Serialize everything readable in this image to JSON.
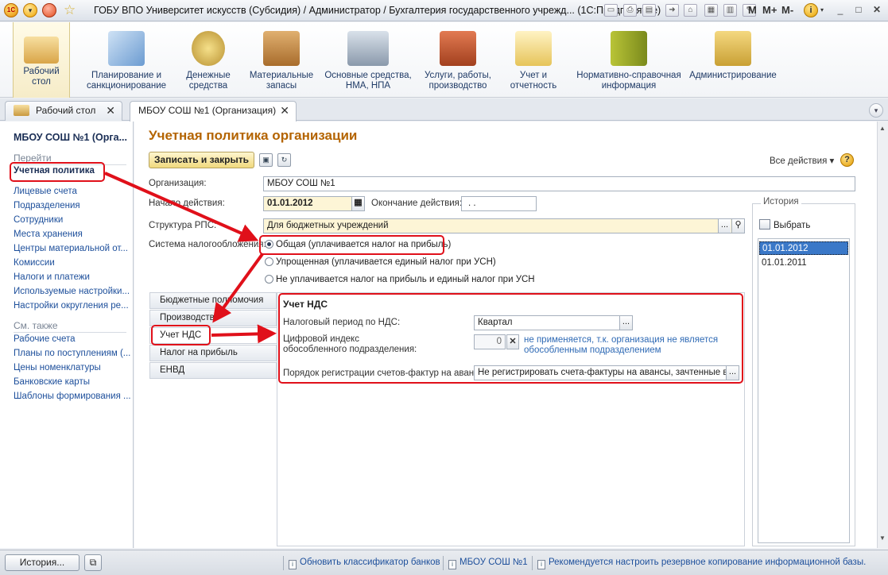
{
  "titlebar": {
    "title": "ГОБУ ВПО Университет искусств (Субсидия) / Администратор / Бухгалтерия государственного учрежд... (1С:Предприятие)",
    "m_labels": [
      "M",
      "M+",
      "M-"
    ]
  },
  "ribbon": {
    "items": [
      {
        "label": "Рабочий\nстол",
        "icon": "desk-icon"
      },
      {
        "label": "Планирование и\nсанкционирование",
        "icon": "planning-chart-icon"
      },
      {
        "label": "Денежные\nсредства",
        "icon": "coins-icon"
      },
      {
        "label": "Материальные\nзапасы",
        "icon": "boxes-icon"
      },
      {
        "label": "Основные средства,\nНМА, НПА",
        "icon": "truck-icon"
      },
      {
        "label": "Услуги, работы,\nпроизводство",
        "icon": "toolbox-icon"
      },
      {
        "label": "Учет и\nотчетность",
        "icon": "reports-icon"
      },
      {
        "label": "Нормативно-справочная\nинформация",
        "icon": "binders-icon"
      },
      {
        "label": "Администрирование",
        "icon": "admin-computer-icon"
      }
    ]
  },
  "tabs": [
    {
      "label": "Рабочий стол",
      "active": false
    },
    {
      "label": "МБОУ СОШ №1 (Организация)",
      "active": true
    }
  ],
  "left_panel": {
    "title": "МБОУ СОШ №1 (Орга...",
    "goto_section": "Перейти",
    "goto_items": [
      "Учетная политика",
      "Лицевые счета",
      "Подразделения",
      "Сотрудники",
      "Места хранения",
      "Центры материальной от...",
      "Комиссии",
      "Налоги и платежи",
      "Используемые настройки...",
      "Настройки округления ре..."
    ],
    "see_also_section": "См. также",
    "see_also_items": [
      "Рабочие счета",
      "Планы по поступлениям (...",
      "Цены номенклатуры",
      "Банковские карты",
      "Шаблоны формирования ..."
    ]
  },
  "form": {
    "title": "Учетная политика организации",
    "save_close": "Записать и закрыть",
    "all_actions": "Все действия ▾",
    "org_label": "Организация:",
    "org_value": "МБОУ СОШ №1",
    "start_label": "Начало действия:",
    "start_value": "01.01.2012",
    "end_label": "Окончание действия:",
    "end_value": ". .",
    "rps_label": "Структура РПС:",
    "rps_value": "Для бюджетных учреждений",
    "tax_label": "Система налогообложения:",
    "tax_options": [
      {
        "label": "Общая (уплачивается налог на прибыль)",
        "selected": true
      },
      {
        "label": "Упрощенная (уплачивается единый налог при УСН)",
        "selected": false
      },
      {
        "label": "Не уплачивается налог на прибыль и единый налог при УСН",
        "selected": false
      }
    ],
    "side_tabs": [
      "Бюджетные полномочия",
      "Производство",
      "Учет НДС",
      "Налог на прибыль",
      "ЕНВД"
    ],
    "selected_side_tab": "Учет НДС",
    "vat": {
      "header": "Учет НДС",
      "period_label": "Налоговый период по НДС:",
      "period_value": "Квартал",
      "index_label_1": "Цифровой индекс",
      "index_label_2": "обособленного подразделения:",
      "index_value": "0",
      "index_note_1": "не применяется, т.к. организация не является",
      "index_note_2": "обособленным подразделением",
      "invoice_label": "Порядок регистрации счетов-фактур на аванс:",
      "invoice_value": "Не регистрировать счета-фактуры на авансы, зачтенные в те"
    }
  },
  "history": {
    "title": "История",
    "select_label": "Выбрать",
    "rows": [
      "01.01.2012",
      "01.01.2011"
    ],
    "selected": "01.01.2012"
  },
  "statusbar": {
    "history_btn": "История...",
    "links": [
      "Обновить классификатор банков",
      "МБОУ СОШ №1",
      "Рекомендуется настроить резервное копирование информационной базы."
    ]
  },
  "colors": {
    "title_orange": "#b46400",
    "annotation_red": "#e0101a",
    "link_blue": "#1d4f9b",
    "selected_blue": "#3a78c8"
  }
}
